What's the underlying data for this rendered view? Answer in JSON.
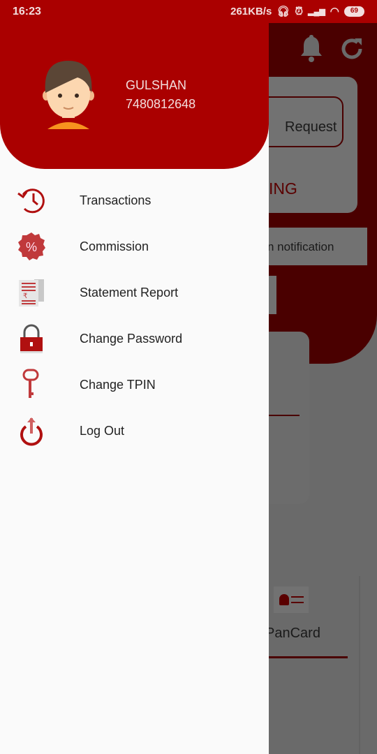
{
  "status_bar": {
    "time": "16:23",
    "net_speed": "261KB/s",
    "battery": "69",
    "network": "4G"
  },
  "drawer": {
    "user": {
      "name": "GULSHAN",
      "phone": "7480812648"
    },
    "items": [
      {
        "label": "Transactions",
        "icon": "history-icon"
      },
      {
        "label": "Commission",
        "icon": "percent-badge-icon"
      },
      {
        "label": "Statement Report",
        "icon": "statement-icon"
      },
      {
        "label": "Change Password",
        "icon": "lock-icon"
      },
      {
        "label": "Change TPIN",
        "icon": "key-icon"
      },
      {
        "label": "Log Out",
        "icon": "power-icon"
      }
    ]
  },
  "background": {
    "request_label": "Request",
    "status_partial": "ING",
    "notification_partial": "n notification",
    "pancard_label": "PanCard"
  },
  "colors": {
    "brand": "#aa0000",
    "scrim_dark_red": "#4a0000"
  }
}
